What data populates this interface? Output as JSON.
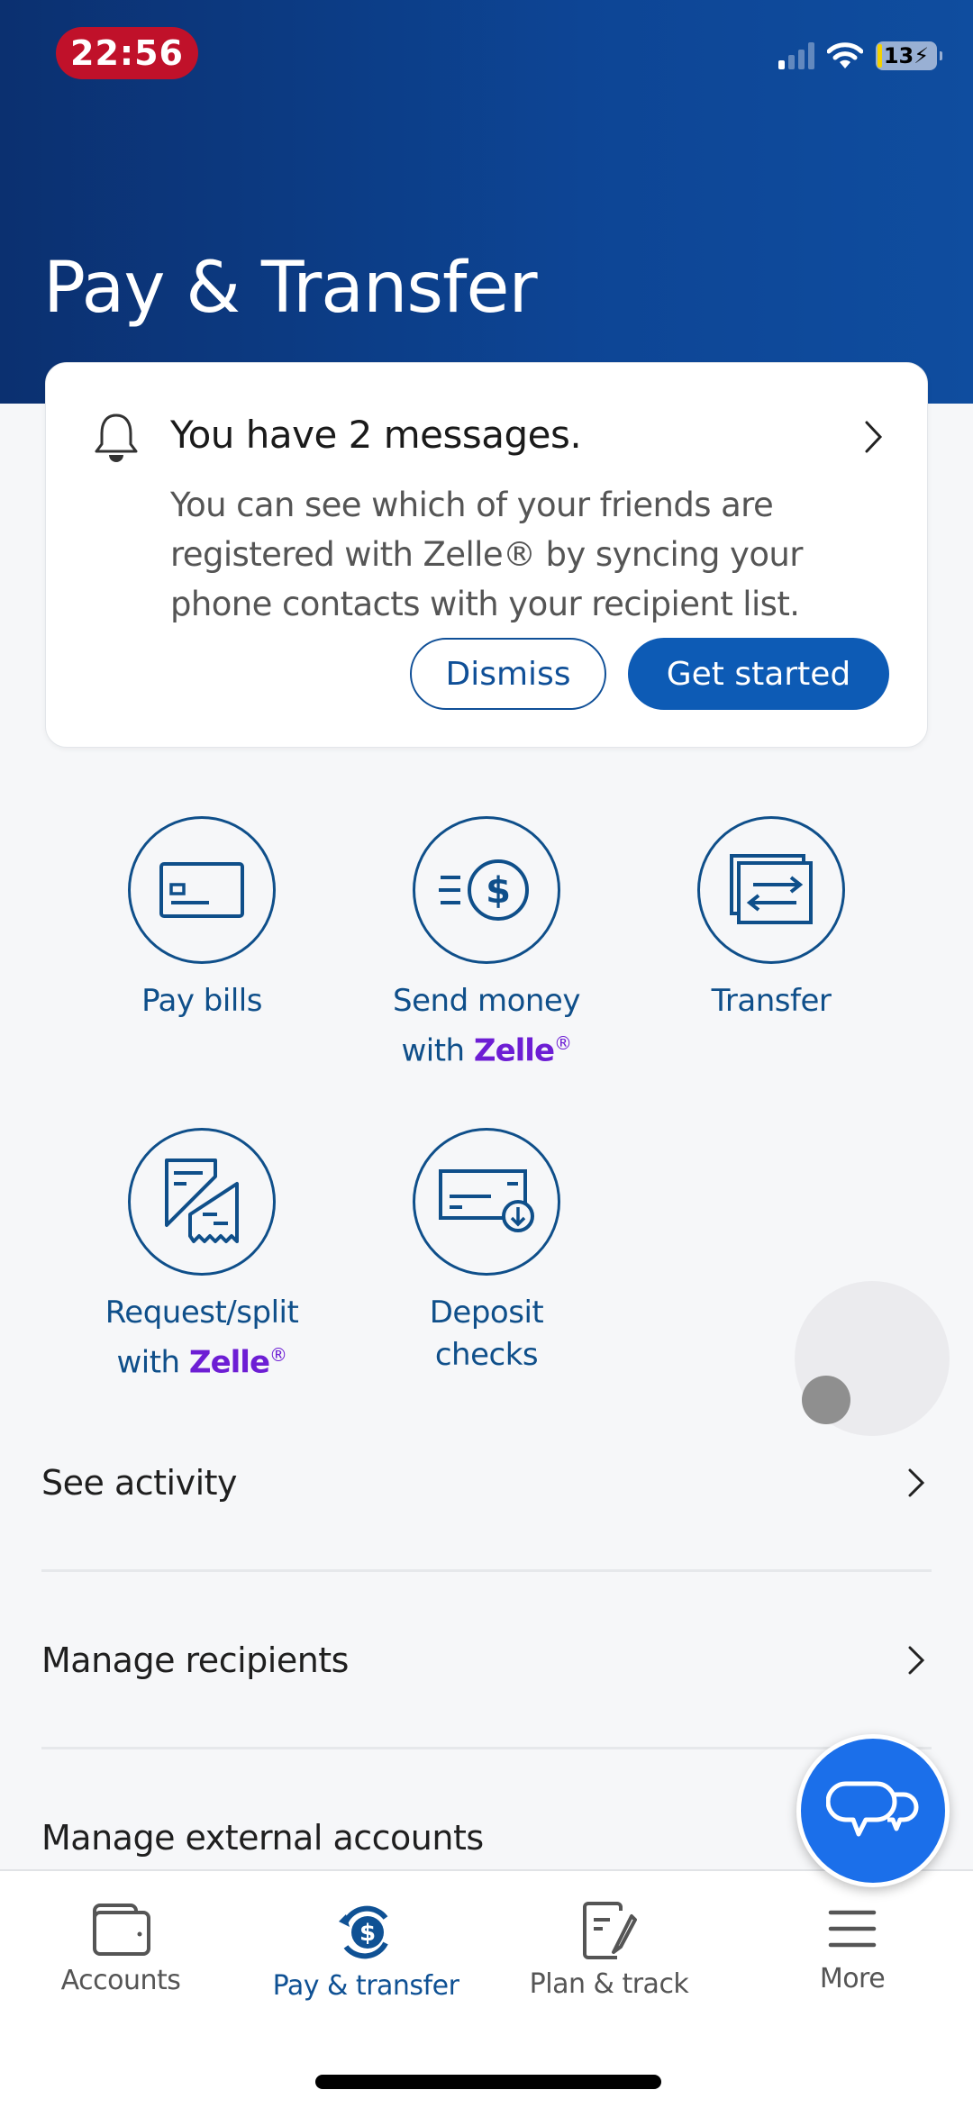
{
  "status_bar": {
    "time": "22:56",
    "battery": "13"
  },
  "header": {
    "title": "Pay & Transfer"
  },
  "message_card": {
    "title": "You have 2 messages.",
    "body": "You can see which of your friends are registered with Zelle® by syncing your phone contacts with your recipient list.",
    "dismiss_label": "Dismiss",
    "get_started_label": "Get started"
  },
  "actions": [
    {
      "line1": "Pay bills",
      "line2_prefix": "",
      "brand": "",
      "icon": "bill-card-icon"
    },
    {
      "line1": "Send money",
      "line2_prefix": "with ",
      "brand": "Zelle",
      "reg": "®",
      "icon": "send-dollar-icon"
    },
    {
      "line1": "Transfer",
      "line2_prefix": "",
      "brand": "",
      "icon": "transfer-arrows-icon"
    },
    {
      "line1": "Request/split",
      "line2_prefix": "with ",
      "brand": "Zelle",
      "reg": "®",
      "icon": "split-receipt-icon"
    },
    {
      "line1": "Deposit",
      "line2": "checks",
      "icon": "deposit-check-icon"
    }
  ],
  "list": [
    {
      "label": "See activity"
    },
    {
      "label": "Manage recipients"
    },
    {
      "label": "Manage external accounts"
    }
  ],
  "bottom_nav": [
    {
      "label": "Accounts",
      "active": false
    },
    {
      "label": "Pay & transfer",
      "active": true
    },
    {
      "label": "Plan & track",
      "active": false
    },
    {
      "label": "More",
      "active": false
    }
  ],
  "colors": {
    "header_blue": "#0b3070",
    "primary_blue": "#0d5bb5",
    "icon_blue": "#0f4f8a",
    "zelle_purple": "#6d1ed4",
    "chat_blue": "#1b6fea",
    "time_badge_red": "#c0112a"
  }
}
